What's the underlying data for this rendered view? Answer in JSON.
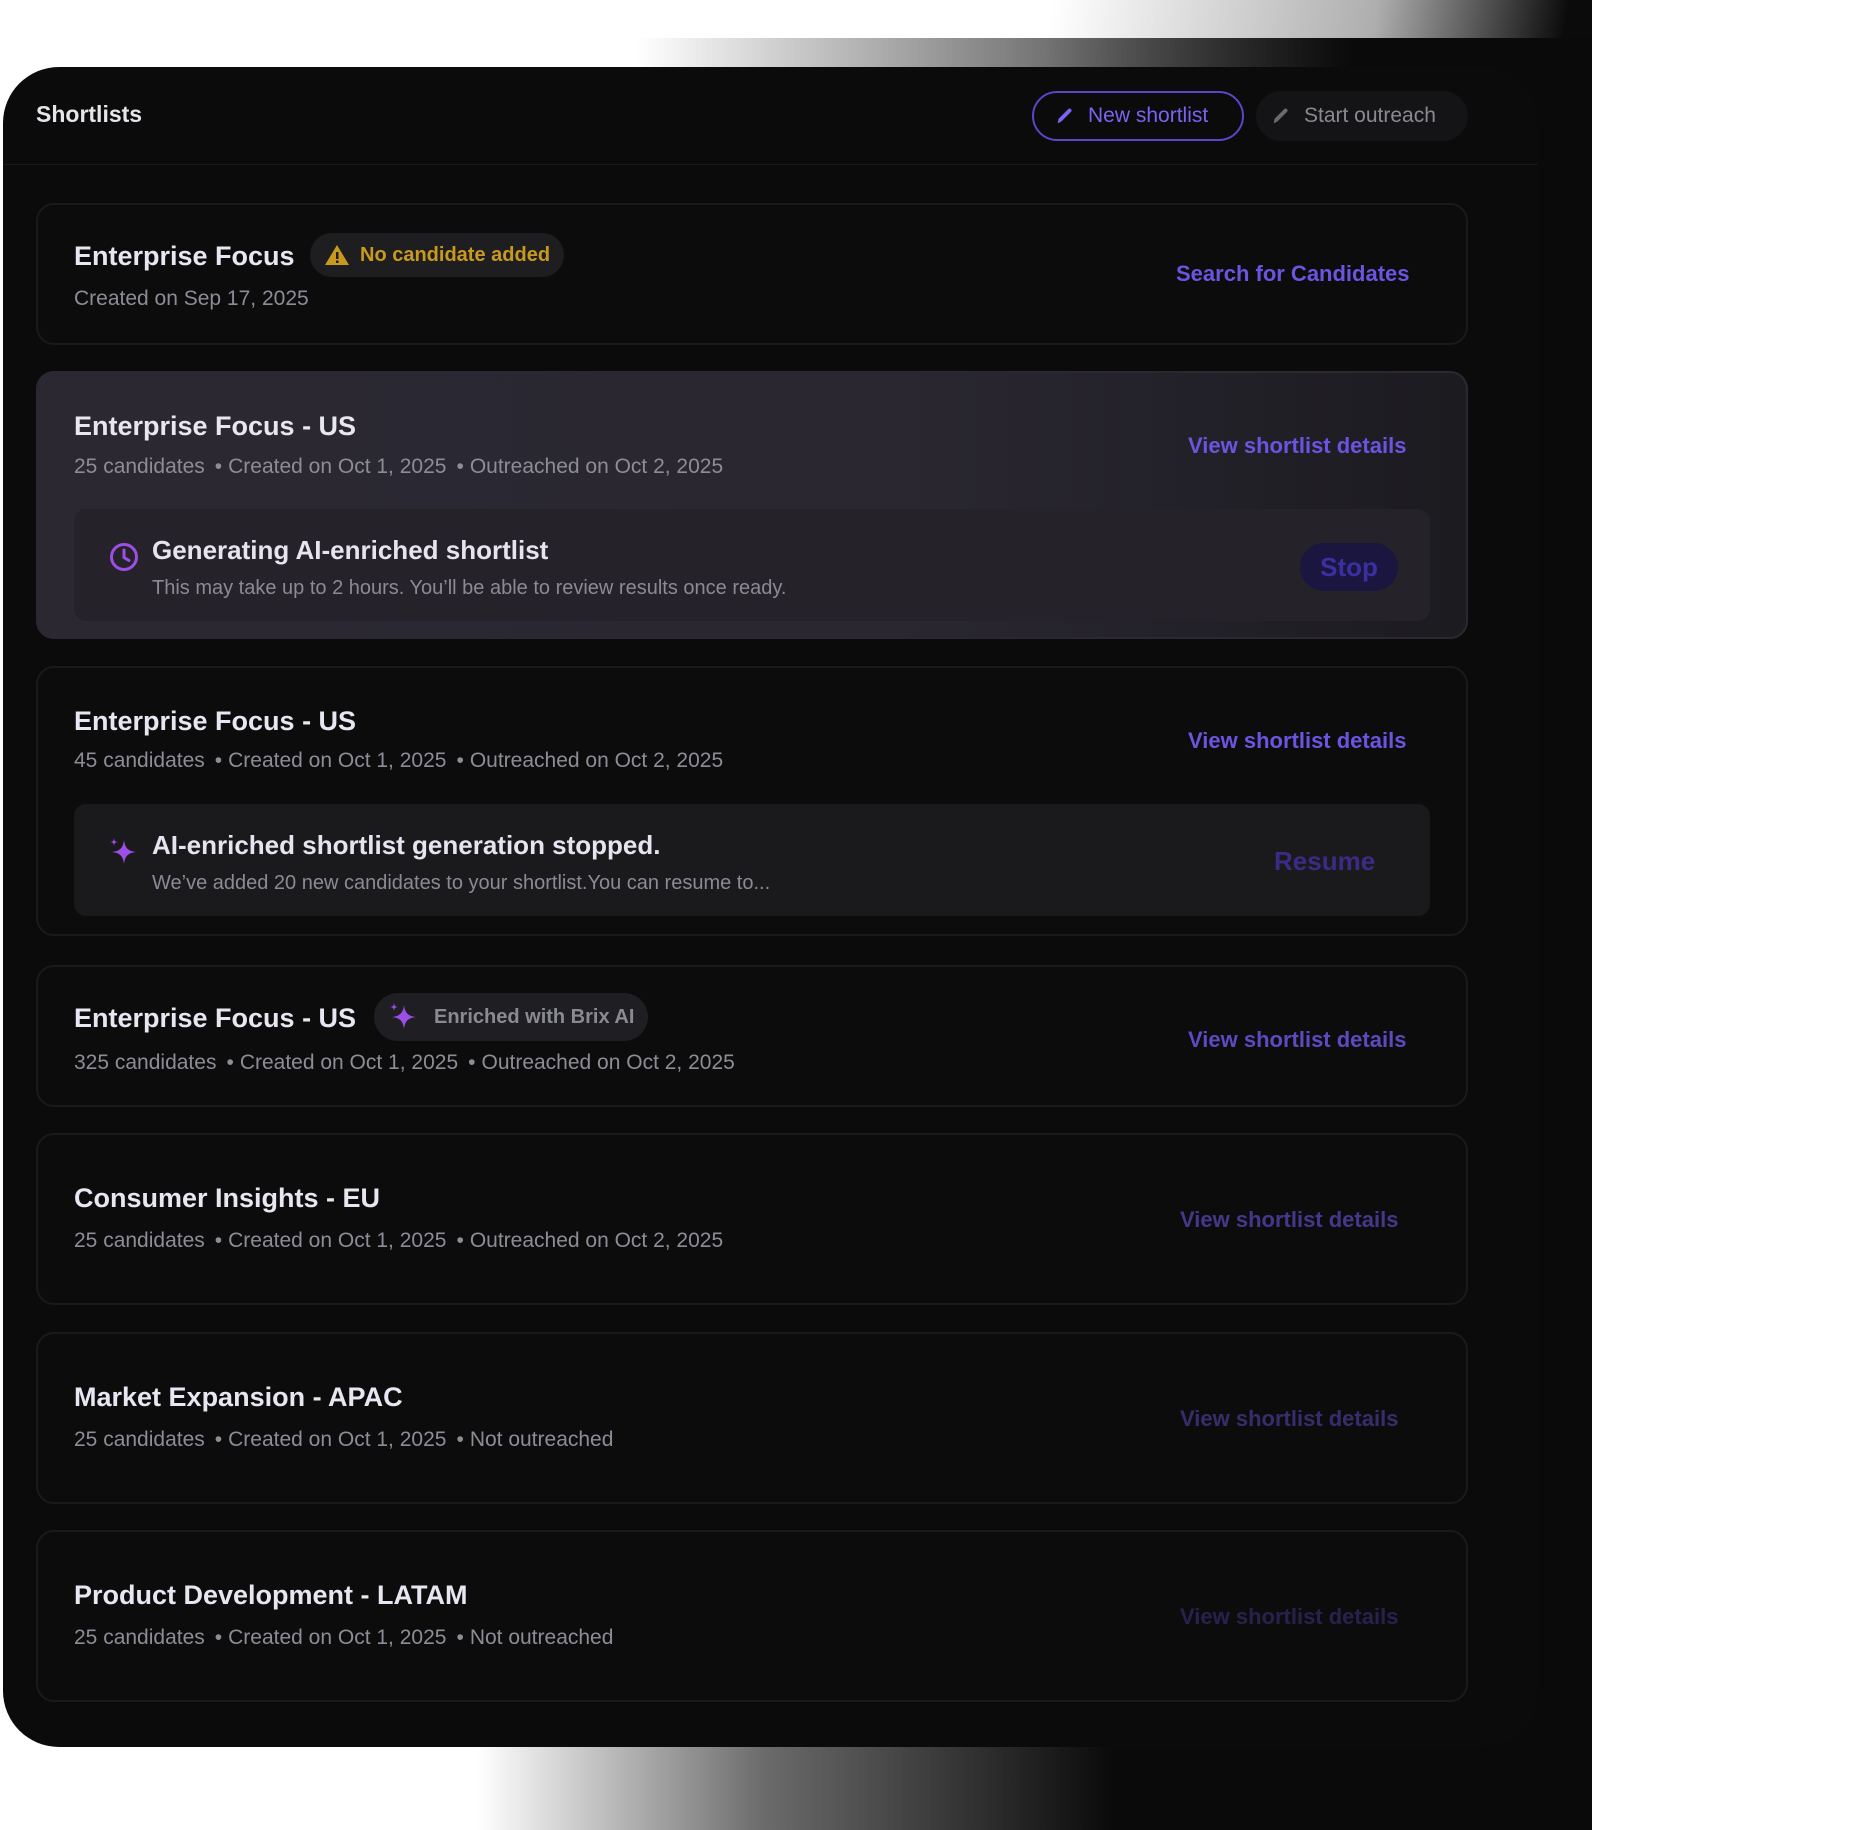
{
  "header": {
    "title": "Shortlists",
    "new_shortlist_label": "New shortlist",
    "start_outreach_label": "Start outreach"
  },
  "cards": [
    {
      "title": "Enterprise Focus",
      "badge": "No candidate added",
      "meta": "Created on Sep 17, 2025",
      "link": "Search for Candidates"
    },
    {
      "title": "Enterprise Focus - US",
      "meta_candidates": "25 candidates",
      "meta_created": "Created on Oct 1, 2025",
      "meta_outreach": "Outreached on Oct 2, 2025",
      "link": "View shortlist details",
      "inner_title": "Generating AI-enriched shortlist",
      "inner_sub": "This may take up to 2 hours. You’ll be able to review results once ready.",
      "inner_action": "Stop"
    },
    {
      "title": "Enterprise Focus - US",
      "meta_candidates": "45 candidates",
      "meta_created": "Created on Oct 1, 2025",
      "meta_outreach": "Outreached on Oct 2, 2025",
      "link": "View shortlist details",
      "inner_title": "AI-enriched shortlist generation stopped.",
      "inner_sub": "We’ve added 20 new candidates to your shortlist.You can resume to...",
      "inner_action": "Resume"
    },
    {
      "title": "Enterprise Focus - US",
      "badge": "Enriched with Brix AI",
      "meta_candidates": "325 candidates",
      "meta_created": "Created on Oct 1, 2025",
      "meta_outreach": "Outreached on Oct 2, 2025",
      "link": "View shortlist details"
    },
    {
      "title": "Consumer Insights - EU",
      "meta_candidates": "25 candidates",
      "meta_created": "Created on Oct 1, 2025",
      "meta_outreach": "Outreached on Oct 2, 2025",
      "link": "View shortlist details"
    },
    {
      "title": "Market Expansion - APAC",
      "meta_candidates": "25 candidates",
      "meta_created": "Created on Oct 1, 2025",
      "meta_outreach": "Not outreached",
      "link": "View shortlist details"
    },
    {
      "title": "Product Development - LATAM",
      "meta_candidates": "25 candidates",
      "meta_created": "Created on Oct 1, 2025",
      "meta_outreach": "Not outreached",
      "link": "View shortlist details"
    }
  ],
  "colors": {
    "accent": "#6d54e0",
    "warning": "#c79a1f",
    "panel_bg": "#0b0b0c"
  },
  "icons": [
    "pencil-icon",
    "warning-icon",
    "clock-icon",
    "sparkle-icon"
  ]
}
